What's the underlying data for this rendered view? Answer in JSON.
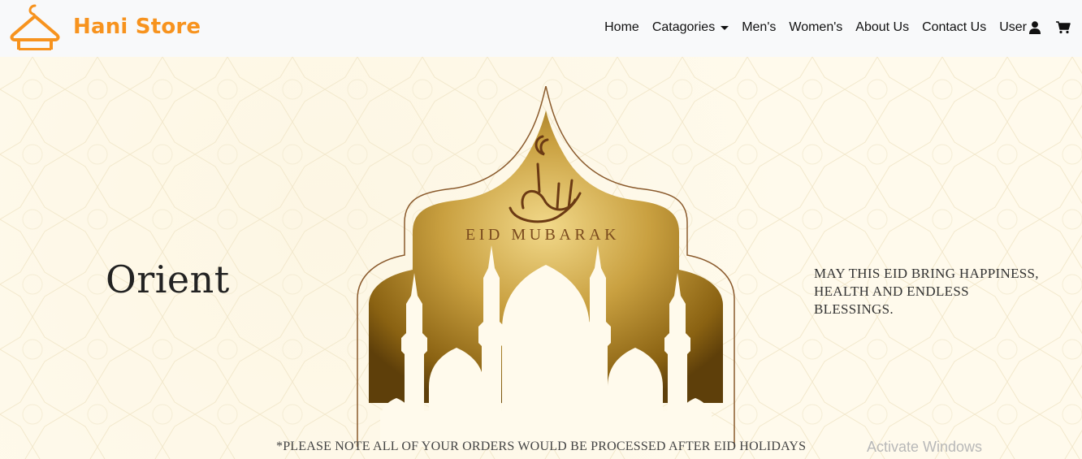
{
  "brand": {
    "name": "Hani Store",
    "logo_icon": "hanger-icon",
    "color": "#f7931e"
  },
  "nav": {
    "items": [
      {
        "label": "Home"
      },
      {
        "label": "Catagories",
        "dropdown": true
      },
      {
        "label": "Men's"
      },
      {
        "label": "Women's"
      },
      {
        "label": "About Us"
      },
      {
        "label": "Contact Us"
      },
      {
        "label": "User",
        "icon": "user-icon"
      }
    ],
    "cart_icon": "cart-icon"
  },
  "hero": {
    "left_title": "Orient",
    "center_text": "EID MUBARAK",
    "right_text": "May this EID bring happiness, health and endless blessings.",
    "notice": "*Please note all of your orders would be processed after EID holidays"
  },
  "overlay": {
    "watermark": "Activate Windows"
  }
}
